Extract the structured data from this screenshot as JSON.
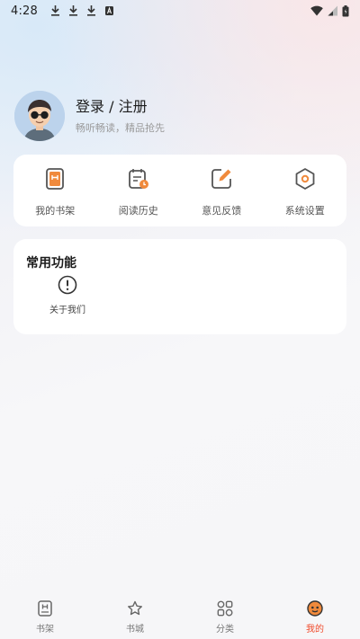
{
  "status_bar": {
    "time": "4:28"
  },
  "profile": {
    "login_label": "登录 / 注册",
    "slogan": "畅听畅读，精品抢先"
  },
  "quick_actions": [
    {
      "label": "我的书架",
      "icon": "bookshelf-icon"
    },
    {
      "label": "阅读历史",
      "icon": "reading-history-icon"
    },
    {
      "label": "意见反馈",
      "icon": "feedback-icon"
    },
    {
      "label": "系统设置",
      "icon": "settings-icon"
    }
  ],
  "common_functions": {
    "title": "常用功能",
    "items": [
      {
        "label": "关于我们",
        "icon": "info-icon"
      }
    ]
  },
  "bottom_nav": {
    "items": [
      {
        "label": "书架",
        "icon": "bookshelf-icon"
      },
      {
        "label": "书城",
        "icon": "bookstore-icon"
      },
      {
        "label": "分类",
        "icon": "category-icon"
      },
      {
        "label": "我的",
        "icon": "profile-icon",
        "active": true
      }
    ]
  },
  "colors": {
    "accent": "#f04a2b",
    "icon_orange": "#f08a3c",
    "icon_dark": "#555555"
  }
}
